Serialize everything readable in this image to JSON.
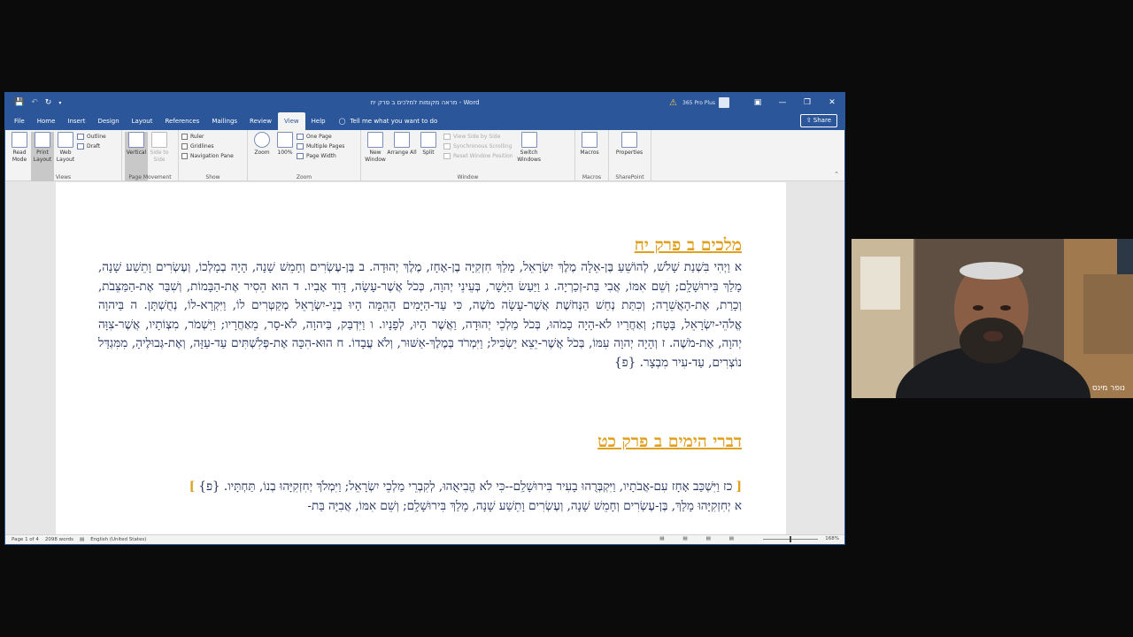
{
  "window": {
    "title": "מראה מקומות למלכים ב פרק יח - Word",
    "account": "365 Pro Plus"
  },
  "tabs": [
    "File",
    "Home",
    "Insert",
    "Design",
    "Layout",
    "References",
    "Mailings",
    "Review",
    "View",
    "Help"
  ],
  "active_tab": "View",
  "tell_me": "Tell me what you want to do",
  "share_label": "Share",
  "ribbon": {
    "views": {
      "label": "Views",
      "read_mode": "Read Mode",
      "print_layout": "Print Layout",
      "web_layout": "Web Layout",
      "outline": "Outline",
      "draft": "Draft"
    },
    "page_movement": {
      "label": "Page Movement",
      "vertical": "Vertical",
      "side_to_side": "Side to Side"
    },
    "show": {
      "label": "Show",
      "ruler": "Ruler",
      "gridlines": "Gridlines",
      "navigation_pane": "Navigation Pane"
    },
    "zoom": {
      "label": "Zoom",
      "zoom": "Zoom",
      "hundred": "100%",
      "one_page": "One Page",
      "multiple_pages": "Multiple Pages",
      "page_width": "Page Width"
    },
    "window": {
      "label": "Window",
      "new_window": "New Window",
      "arrange_all": "Arrange All",
      "split": "Split",
      "view_side_by_side": "View Side by Side",
      "synchronous_scrolling": "Synchronous Scrolling",
      "reset_window_position": "Reset Window Position",
      "switch_windows": "Switch Windows"
    },
    "macros": {
      "label": "Macros",
      "macros": "Macros"
    },
    "sharepoint": {
      "label": "SharePoint",
      "properties": "Properties"
    }
  },
  "document": {
    "heading1": "מלכים ב פרק יח",
    "para1": "א וַיְהִי בִּשְׁנַת שָׁלֹשׁ, לְהוֹשֵׁעַ בֶּן-אֵלָה מֶלֶךְ יִשְׂרָאֵל, מָלַךְ חִזְקִיָּה בֶן-אָחָז, מֶלֶךְ יְהוּדָה. ב בֶּן-עֶשְׂרִים וְחָמֵשׁ שָׁנָה, הָיָה בְמָלְכוֹ, וְעֶשְׂרִים וָתֵשַׁע שָׁנָה, מָלַךְ בִּירוּשָׁלִָם; וְשֵׁם אִמּוֹ, אֲבִי בַּת-זְכַרְיָה. ג וַיַּעַשׂ הַיָּשָׁר, בְּעֵינֵי יְהוָה, כְּכֹל אֲשֶׁר-עָשָׂה, דָּוִד אָבִיו. ד הוּא הֵסִיר אֶת-הַבָּמוֹת, וְשִׁבַּר אֶת-הַמַּצֵּבֹת, וְכָרַת, אֶת-הָאֲשֵׁרָה; וְכִתַּת נְחַשׁ הַנְּחֹשֶׁת אֲשֶׁר-עָשָׂה מֹשֶׁה, כִּי עַד-הַיָּמִים הָהֵמָּה הָיוּ בְנֵי-יִשְׂרָאֵל מְקַטְּרִים לוֹ, וַיִּקְרָא-לוֹ, נְחֻשְׁתָּן. ה בַּיהוָה אֱלֹהֵי-יִשְׂרָאֵל, בָּטָח; וְאַחֲרָיו לֹא-הָיָה כָמֹהוּ, בְּכֹל מַלְכֵי יְהוּדָה, וַאֲשֶׁר הָיוּ, לְפָנָיו. ו וַיִּדְבַּק, בַּיהוָה, לֹא-סָר, מֵאַחֲרָיו; וַיִּשְׁמֹר, מִצְוֹתָיו, אֲשֶׁר-צִוָּה יְהוָה, אֶת-מֹשֶׁה. ז וְהָיָה יְהוָה עִמּוֹ, בְּכֹל אֲשֶׁר-יֵצֵא יַשְׂכִּיל; וַיִּמְרֹד בְּמֶלֶךְ-אַשּׁוּר, וְלֹא עֲבָדוֹ. ח הוּא-הִכָּה אֶת-פְּלִשְׁתִּים עַד-עַזָּה, וְאֶת-גְּבוּלֶיהָ, מִמִּגְדַּל נוֹצְרִים, עַד-עִיר מִבְצָר. {פ}",
    "heading2": "דברי הימים ב פרק כט",
    "bracket_open": "[",
    "bracket_close": "]",
    "para2": "כז וַיִּשְׁכַּב אָחָז עִם-אֲבֹתָיו, וַיִּקְבְּרֻהוּ בָעִיר בִּירוּשָׁלִַם--כִּי לֹא הֱבִיאֻהוּ, לְקִבְרֵי מַלְכֵי יִשְׂרָאֵל; וַיִּמְלֹךְ יְחִזְקִיָּהוּ בְנוֹ, תַּחְתָּיו. {פ}",
    "para3": "א יְחִזְקִיָּהוּ מָלַךְ, בֶּן-עֶשְׂרִים וְחָמֵשׁ שָׁנָה, וְעֶשְׂרִים וָתֵשַׁע שָׁנָה, מָלַךְ בִּירוּשָׁלִָם; וְשֵׁם אִמּוֹ, אֲבִיָּה בַּת-"
  },
  "status": {
    "page": "Page 1 of 4",
    "words": "2098 words",
    "language": "English (United States)",
    "zoom": "168%"
  },
  "video": {
    "participant_name": "נופר מינס"
  }
}
